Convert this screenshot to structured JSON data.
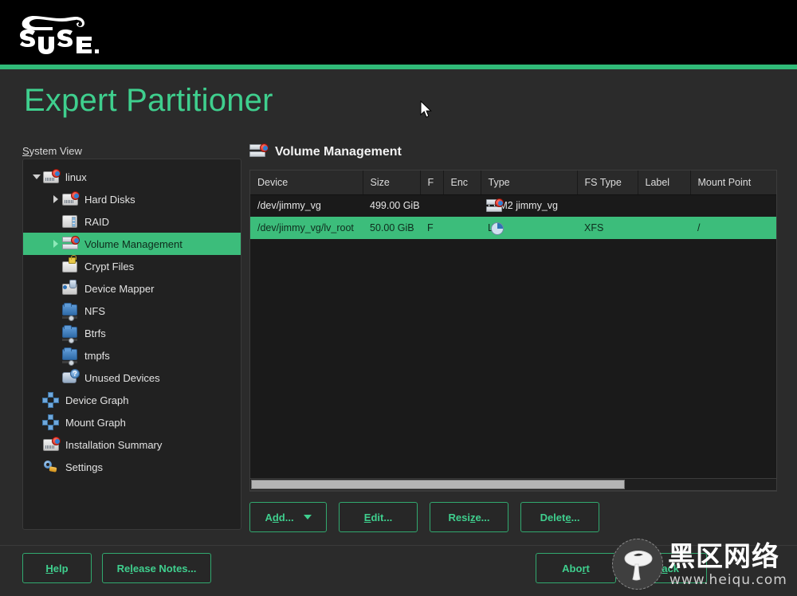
{
  "window": {
    "brand": "SUSE",
    "accent_color": "#30ba78",
    "selection_color": "#3cbd7b",
    "title": "Expert Partitioner"
  },
  "sidebar": {
    "label": "System View",
    "label_accesskey": "S",
    "items": [
      {
        "label": "linux",
        "icon": "hard-disk-icon",
        "depth": 0,
        "twisty": "down",
        "selected": false
      },
      {
        "label": "Hard Disks",
        "icon": "hard-disk-icon",
        "depth": 1,
        "twisty": "right",
        "selected": false
      },
      {
        "label": "RAID",
        "icon": "raid-icon",
        "depth": 1,
        "twisty": "none",
        "selected": false
      },
      {
        "label": "Volume Management",
        "icon": "volume-group-icon",
        "depth": 1,
        "twisty": "right",
        "selected": true
      },
      {
        "label": "Crypt Files",
        "icon": "crypt-file-icon",
        "depth": 1,
        "twisty": "none",
        "selected": false
      },
      {
        "label": "Device Mapper",
        "icon": "device-mapper-icon",
        "depth": 1,
        "twisty": "none",
        "selected": false
      },
      {
        "label": "NFS",
        "icon": "folder-network-icon",
        "depth": 1,
        "twisty": "none",
        "selected": false
      },
      {
        "label": "Btrfs",
        "icon": "folder-network-icon",
        "depth": 1,
        "twisty": "none",
        "selected": false
      },
      {
        "label": "tmpfs",
        "icon": "folder-network-icon",
        "depth": 1,
        "twisty": "none",
        "selected": false
      },
      {
        "label": "Unused Devices",
        "icon": "unused-devices-icon",
        "depth": 1,
        "twisty": "none",
        "selected": false
      },
      {
        "label": "Device Graph",
        "icon": "graph-icon",
        "depth": 0,
        "twisty": "none",
        "selected": false
      },
      {
        "label": "Mount Graph",
        "icon": "graph-icon",
        "depth": 0,
        "twisty": "none",
        "selected": false
      },
      {
        "label": "Installation Summary",
        "icon": "hard-disk-icon",
        "depth": 0,
        "twisty": "none",
        "selected": false
      },
      {
        "label": "Settings",
        "icon": "wrench-icon",
        "depth": 0,
        "twisty": "none",
        "selected": false
      }
    ]
  },
  "main": {
    "heading": "Volume Management",
    "heading_icon": "volume-group-icon",
    "columns": [
      "Device",
      "Size",
      "F",
      "Enc",
      "Type",
      "FS Type",
      "Label",
      "Mount Point"
    ],
    "rows": [
      {
        "device": "/dev/jimmy_vg",
        "size": "499.00 GiB",
        "f": "",
        "enc": "",
        "type": "LVM2 jimmy_vg",
        "type_icon": "volume-group-icon",
        "fs_type": "",
        "label": "",
        "mount_point": "",
        "selected": false
      },
      {
        "device": "/dev/jimmy_vg/lv_root",
        "size": "50.00 GiB",
        "f": "F",
        "enc": "",
        "type": "LV",
        "type_icon": "logical-volume-icon",
        "fs_type": "XFS",
        "label": "",
        "mount_point": "/",
        "selected": true
      }
    ],
    "scrollbar": {
      "orientation": "horizontal",
      "thumb_percent": 71
    },
    "actions": [
      {
        "label": "Add...",
        "accesskey": "d",
        "has_menu": true
      },
      {
        "label": "Edit...",
        "accesskey": "E",
        "has_menu": false
      },
      {
        "label": "Resize...",
        "accesskey": "z",
        "has_menu": false
      },
      {
        "label": "Delete...",
        "accesskey": "e",
        "has_menu": false
      }
    ]
  },
  "footer": {
    "help": "Help",
    "release_notes": "Release Notes...",
    "abort": "Abort",
    "back": "Back"
  },
  "watermark": {
    "text_cn": "黑区网络",
    "url": "www.heiqu.com"
  }
}
